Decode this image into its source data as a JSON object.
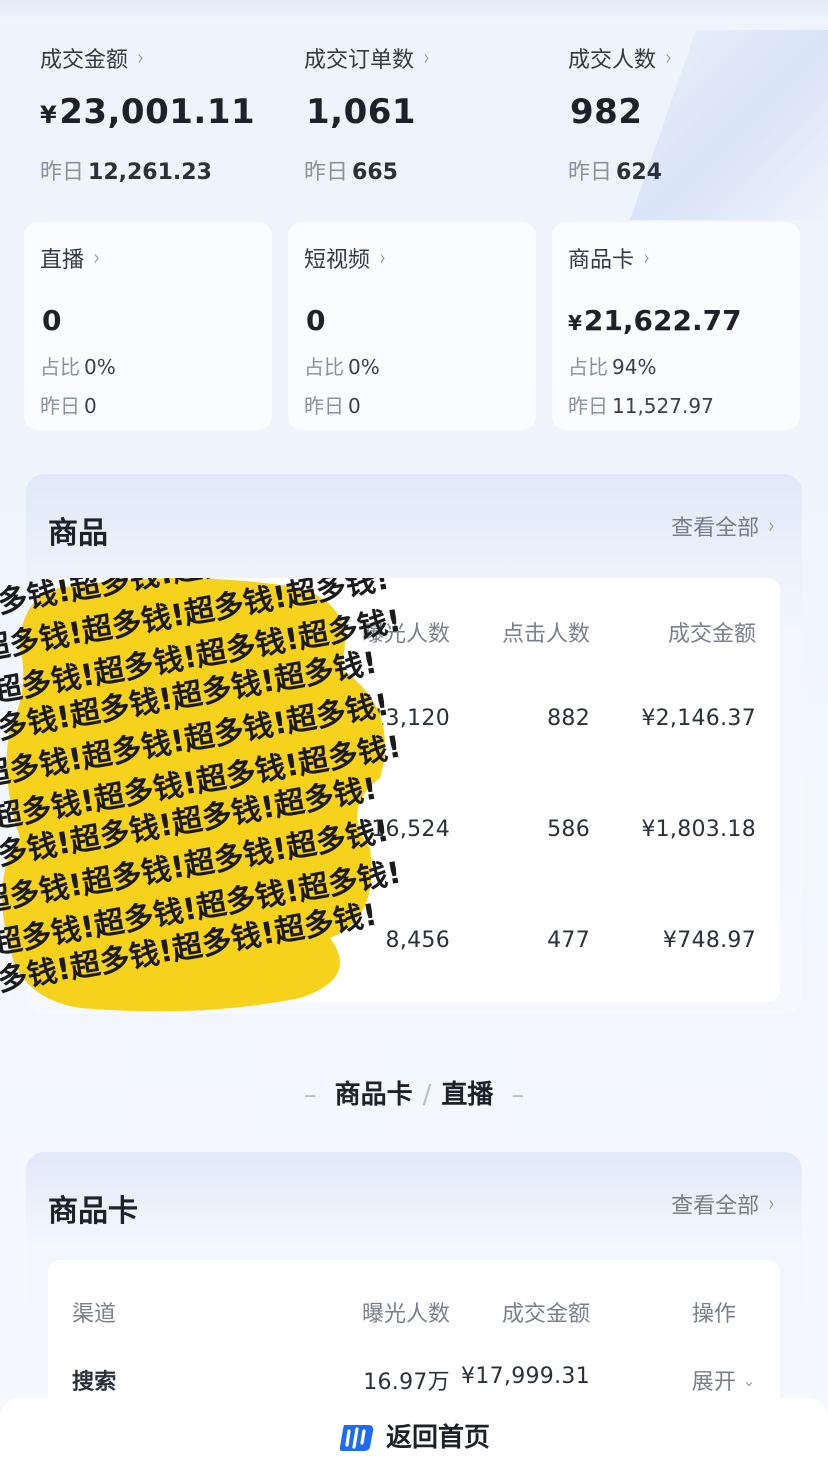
{
  "summary": {
    "metrics": [
      {
        "label": "成交金额",
        "currency": "¥",
        "value": "23,001.11",
        "yesterday_label": "昨日",
        "yesterday": "12,261.23"
      },
      {
        "label": "成交订单数",
        "currency": "",
        "value": "1,061",
        "yesterday_label": "昨日",
        "yesterday": "665"
      },
      {
        "label": "成交人数",
        "currency": "",
        "value": "982",
        "yesterday_label": "昨日",
        "yesterday": "624"
      }
    ],
    "chevron": "›"
  },
  "sources": [
    {
      "label": "直播",
      "currency": "",
      "value": "0",
      "share_label": "占比",
      "share": "0%",
      "yesterday_label": "昨日",
      "yesterday": "0"
    },
    {
      "label": "短视频",
      "currency": "",
      "value": "0",
      "share_label": "占比",
      "share": "0%",
      "yesterday_label": "昨日",
      "yesterday": "0"
    },
    {
      "label": "商品卡",
      "currency": "¥",
      "value": "21,622.77",
      "share_label": "占比",
      "share": "94%",
      "yesterday_label": "昨日",
      "yesterday": "11,527.97"
    }
  ],
  "products": {
    "title": "商品",
    "view_all": "查看全部",
    "columns": [
      "曝光人数",
      "点击人数",
      "成交金额"
    ],
    "rows": [
      {
        "exposure": "13,120",
        "clicks": "882",
        "amount": "¥2,146.37"
      },
      {
        "exposure": "16,524",
        "clicks": "586",
        "amount": "¥1,803.18"
      },
      {
        "exposure": "8,456",
        "clicks": "477",
        "amount": "¥748.97"
      }
    ],
    "sticker_text": "超多钱!",
    "sticker_color": "#f7d21c"
  },
  "section_divider": {
    "left": "商品卡",
    "sep": "/",
    "right": "直播"
  },
  "product_card": {
    "title": "商品卡",
    "view_all": "查看全部",
    "columns": [
      "渠道",
      "曝光人数",
      "成交金额",
      "操作"
    ],
    "rows": [
      {
        "channel": "搜索",
        "exposure": "16.97万",
        "amount": "¥17,999.31",
        "action": "展开"
      }
    ]
  },
  "bottom_bar": {
    "label": "返回首页",
    "icon": "doudian-logo-icon",
    "icon_color": "#1e6bf0"
  },
  "colors": {
    "accent_blue": "#1e6bf0",
    "text_primary": "#1d2129",
    "text_secondary": "#8a919f"
  }
}
